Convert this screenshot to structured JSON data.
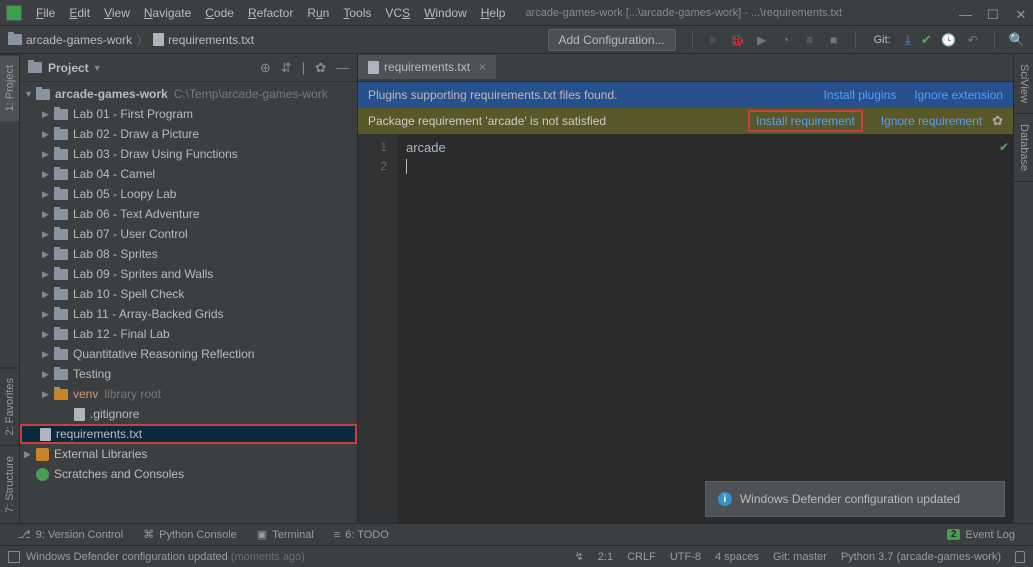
{
  "menu": [
    "File",
    "Edit",
    "View",
    "Navigate",
    "Code",
    "Refactor",
    "Run",
    "Tools",
    "VCS",
    "Window",
    "Help"
  ],
  "title_path": "arcade-games-work [...\\arcade-games-work] - ...\\requirements.txt",
  "breadcrumb": {
    "project": "arcade-games-work",
    "file": "requirements.txt"
  },
  "add_config": "Add Configuration...",
  "git_label": "Git:",
  "panel": {
    "title": "Project"
  },
  "tree": {
    "root": "arcade-games-work",
    "root_path": "C:\\Temp\\arcade-games-work",
    "items": [
      "Lab 01 - First Program",
      "Lab 02 - Draw a Picture",
      "Lab 03 - Draw Using Functions",
      "Lab 04 - Camel",
      "Lab 05 - Loopy Lab",
      "Lab 06 - Text Adventure",
      "Lab 07 - User Control",
      "Lab 08 - Sprites",
      "Lab 09 - Sprites and Walls",
      "Lab 10 - Spell Check",
      "Lab 11 - Array-Backed Grids",
      "Lab 12 - Final Lab",
      "Quantitative Reasoning Reflection",
      "Testing"
    ],
    "venv": "venv",
    "venv_hint": "library root",
    "gitignore": ".gitignore",
    "reqs": "requirements.txt",
    "external": "External Libraries",
    "scratches": "Scratches and Consoles"
  },
  "sidebars": {
    "left": [
      "1: Project",
      "2: Favorites",
      "7: Structure"
    ],
    "right": [
      "SciView",
      "Database"
    ]
  },
  "editor_tab": "requirements.txt",
  "banner1": {
    "msg": "Plugins supporting requirements.txt files found.",
    "link1": "Install plugins",
    "link2": "Ignore extension"
  },
  "banner2": {
    "msg": "Package requirement 'arcade' is not satisfied",
    "link1": "Install requirement",
    "link2": "Ignore requirement"
  },
  "code": {
    "lines": [
      "1",
      "2"
    ],
    "content": "arcade"
  },
  "toast": "Windows Defender configuration updated",
  "bottom_tools": {
    "vc": "9: Version Control",
    "pc": "Python Console",
    "term": "Terminal",
    "todo": "6: TODO",
    "event": "Event Log",
    "badge": "2"
  },
  "status": {
    "msg": "Windows Defender configuration updated",
    "msg_suffix": "(moments ago)",
    "pos": "2:1",
    "eol": "CRLF",
    "enc": "UTF-8",
    "indent": "4 spaces",
    "git": "Git: master",
    "python": "Python 3.7 (arcade-games-work)"
  }
}
